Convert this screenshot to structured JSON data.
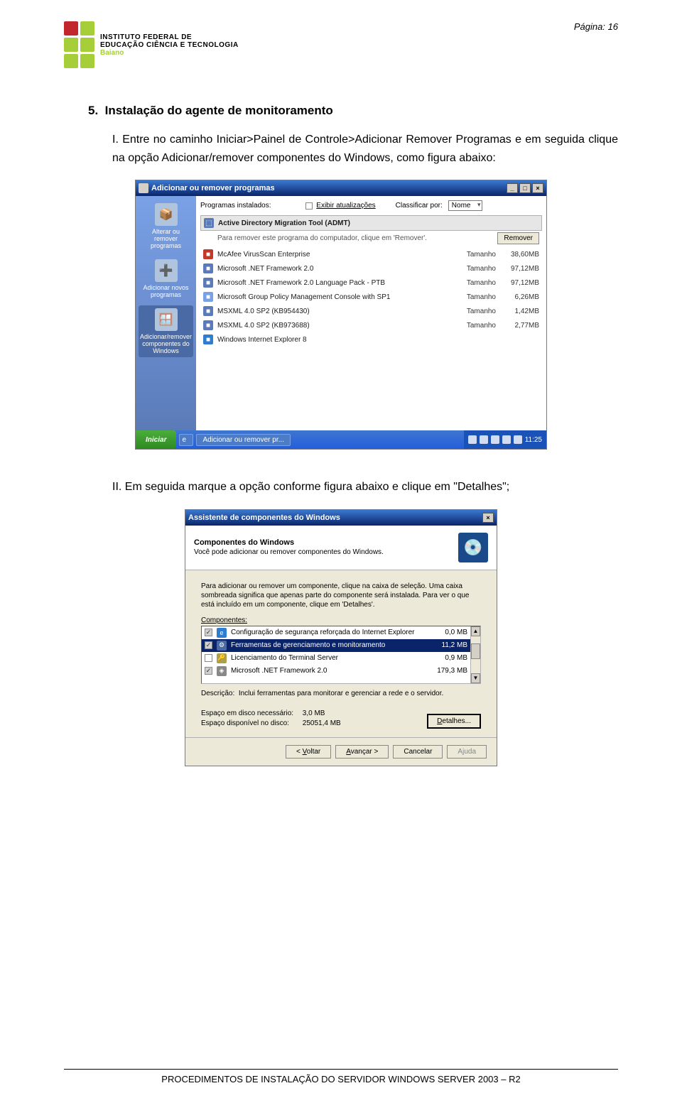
{
  "page_number_label": "Página: 16",
  "logo": {
    "line1": "INSTITUTO FEDERAL DE",
    "line2": "EDUCAÇÃO CIÊNCIA E TECNOLOGIA",
    "line3": "Baiano"
  },
  "section_number": "5.",
  "section_title": "Instalação do agente de monitoramento",
  "para1_prefix": "I.",
  "para1": "Entre no caminho Iniciar>Painel de Controle>Adicionar Remover Programas e em seguida clique na opção Adicionar/remover componentes do Windows, como figura abaixo:",
  "para2_prefix": "II.",
  "para2": "Em seguida marque a opção conforme figura abaixo e clique em \"Detalhes\";",
  "footer": "PROCEDIMENTOS DE INSTALAÇÃO DO SERVIDOR WINDOWS SERVER 2003 – R2",
  "arp": {
    "title": "Adicionar ou remover programas",
    "side_items": [
      {
        "label": "Alterar ou remover programas"
      },
      {
        "label": "Adicionar novos programas"
      },
      {
        "label": "Adicionar/remover componentes do Windows"
      }
    ],
    "topbar": {
      "programs_installed": "Programas instalados:",
      "show_updates": "Exibir atualizações",
      "sort_by_label": "Classificar por:",
      "sort_by_value": "Nome"
    },
    "selected": {
      "name": "Active Directory Migration Tool (ADMT)",
      "subtext": "Para remover este programa do computador, clique em 'Remover'.",
      "remove_btn": "Remover"
    },
    "size_label": "Tamanho",
    "rows": [
      {
        "name": "McAfee VirusScan Enterprise",
        "size": "38,60MB",
        "icon_color": "#c0392b"
      },
      {
        "name": "Microsoft .NET Framework 2.0",
        "size": "97,12MB",
        "icon_color": "#5b7bb8"
      },
      {
        "name": "Microsoft .NET Framework 2.0 Language Pack - PTB",
        "size": "97,12MB",
        "icon_color": "#5b7bb8"
      },
      {
        "name": "Microsoft Group Policy Management Console with SP1",
        "size": "6,26MB",
        "icon_color": "#7aa1e6"
      },
      {
        "name": "MSXML 4.0 SP2 (KB954430)",
        "size": "1,42MB",
        "icon_color": "#5b7bb8"
      },
      {
        "name": "MSXML 4.0 SP2 (KB973688)",
        "size": "2,77MB",
        "icon_color": "#5b7bb8"
      },
      {
        "name": "Windows Internet Explorer 8",
        "size": "",
        "icon_color": "#2e7dd1"
      }
    ],
    "taskbar": {
      "start": "Iniciar",
      "task1": "Adicionar ou remover pr...",
      "clock": "11:25"
    }
  },
  "wiz": {
    "title": "Assistente de componentes do Windows",
    "header_h1": "Componentes do Windows",
    "header_h2": "Você pode adicionar ou remover componentes do Windows.",
    "instruction": "Para adicionar ou remover um componente, clique na caixa de seleção. Uma caixa sombreada significa que apenas parte do componente será instalada. Para ver o que está incluído em um componente, clique em 'Detalhes'.",
    "components_label": "Componentes:",
    "rows": [
      {
        "checked": true,
        "grey": true,
        "name": "Configuração de segurança reforçada do Internet Explorer",
        "size": "0,0 MB",
        "icon": "e",
        "icon_color": "#2e7dd1"
      },
      {
        "checked": true,
        "grey": true,
        "selected": true,
        "name": "Ferramentas de gerenciamento e monitoramento",
        "size": "11,2 MB",
        "icon": "⚙",
        "icon_color": "#4a6aa5"
      },
      {
        "checked": false,
        "name": "Licenciamento do Terminal Server",
        "size": "0,9 MB",
        "icon": "🔑",
        "icon_color": "#aea04b"
      },
      {
        "checked": true,
        "grey": true,
        "name": "Microsoft .NET Framework 2.0",
        "size": "179,3 MB",
        "icon": "◈",
        "icon_color": "#888"
      }
    ],
    "desc_label": "Descrição:",
    "desc_text": "Inclui ferramentas para monitorar e gerenciar a rede e o servidor.",
    "space_needed_label": "Espaço em disco necessário:",
    "space_needed_val": "3,0 MB",
    "space_avail_label": "Espaço disponível no disco:",
    "space_avail_val": "25051,4 MB",
    "details_btn": "Detalhes...",
    "btn_back": "< Voltar",
    "btn_next": "Avançar >",
    "btn_cancel": "Cancelar",
    "btn_help": "Ajuda"
  }
}
